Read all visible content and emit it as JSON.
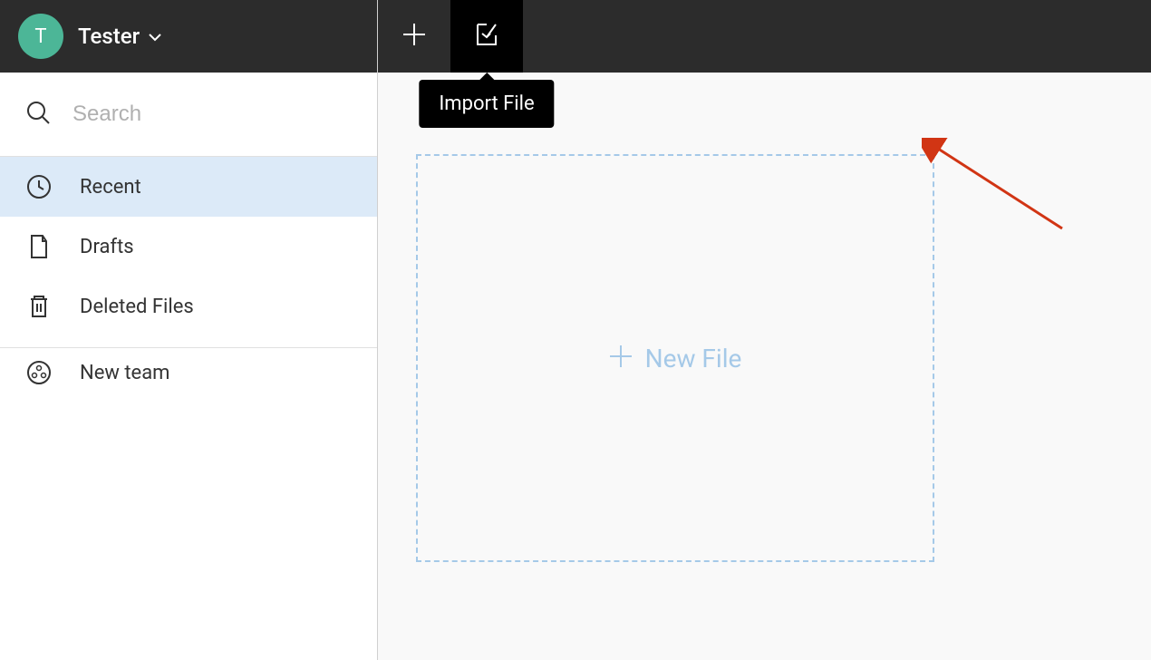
{
  "user": {
    "initial": "T",
    "name": "Tester"
  },
  "search": {
    "placeholder": "Search"
  },
  "sidebar": {
    "items": [
      {
        "label": "Recent"
      },
      {
        "label": "Drafts"
      },
      {
        "label": "Deleted Files"
      }
    ],
    "new_team": "New team"
  },
  "tooltip": {
    "import_file": "Import File"
  },
  "canvas": {
    "new_file": "New File"
  }
}
